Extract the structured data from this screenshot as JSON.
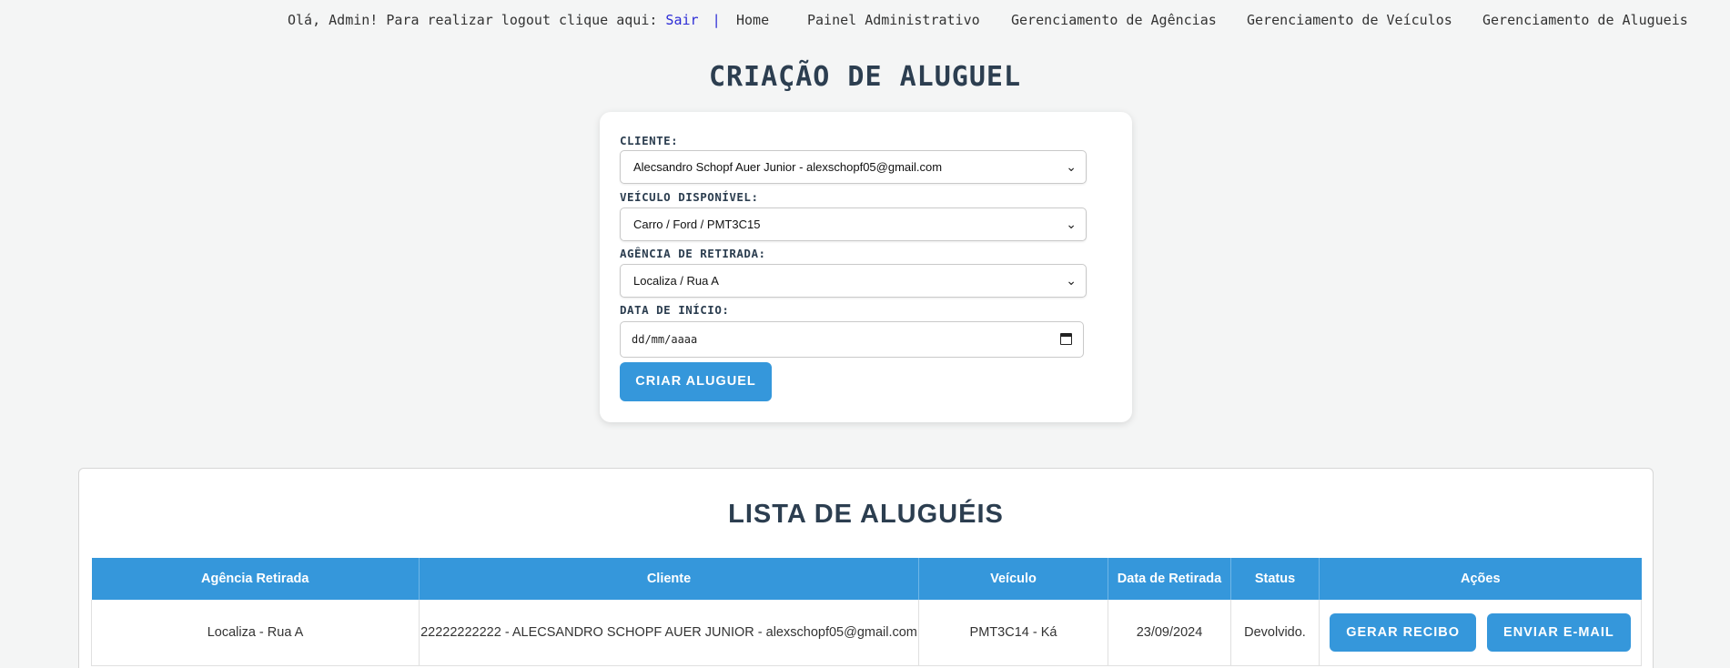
{
  "nav": {
    "greeting": "Olá, Admin! Para realizar logout clique aqui:",
    "logout": "Sair",
    "separator": "|",
    "links": [
      "Home",
      "Painel Administrativo",
      "Gerenciamento de Agências",
      "Gerenciamento de Veículos",
      "Gerenciamento de Alugueis"
    ]
  },
  "form": {
    "title": "CRIAÇÃO DE ALUGUEL",
    "client_label": "CLIENTE:",
    "client_value": "Alecsandro Schopf Auer Junior - alexschopf05@gmail.com",
    "vehicle_label": "VEÍCULO DISPONÍVEL:",
    "vehicle_value": "Carro / Ford / PMT3C15",
    "agency_label": "AGÊNCIA DE RETIRADA:",
    "agency_value": "Localiza / Rua A",
    "date_label": "DATA DE INÍCIO:",
    "date_placeholder": "dd/mm/aaaa",
    "submit": "CRIAR ALUGUEL"
  },
  "list": {
    "title": "LISTA DE ALUGUÉIS",
    "headers": [
      "Agência Retirada",
      "Cliente",
      "Veículo",
      "Data de Retirada",
      "Status",
      "Ações"
    ],
    "rows": [
      {
        "agency": "Localiza - Rua A",
        "client": "22222222222 - ALECSANDRO SCHOPF AUER JUNIOR - alexschopf05@gmail.com",
        "vehicle": "PMT3C14 - Ká",
        "date": "23/09/2024",
        "status": "Devolvido.",
        "action_receipt": "GERAR RECIBO",
        "action_email": "ENVIAR E-MAIL"
      }
    ]
  },
  "colors": {
    "accent": "#3597db",
    "heading": "#2c3e50",
    "background": "#f4f5f5",
    "logout_link": "#2b2bd6"
  }
}
